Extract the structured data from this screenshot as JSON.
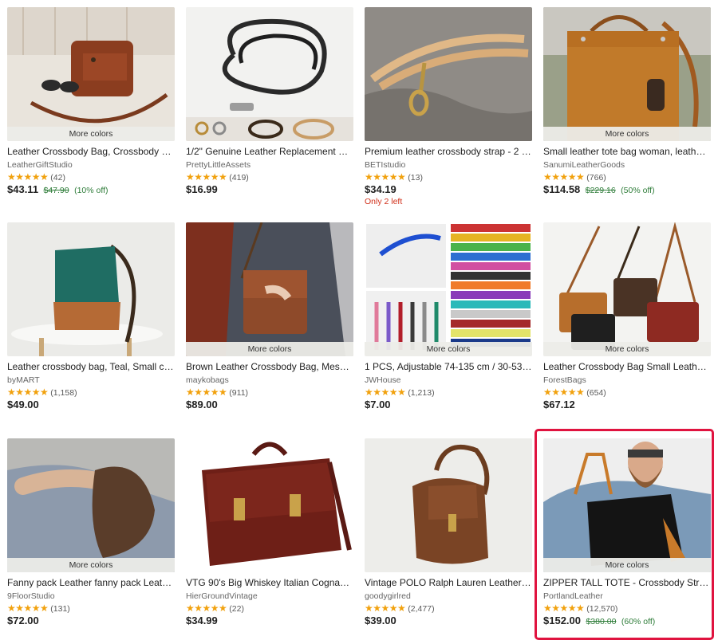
{
  "listings": [
    {
      "more_colors": "More colors",
      "title": "Leather Crossbody Bag, Crossbody Ba...",
      "shop": "LeatherGiftStudio",
      "stars": "★★★★★",
      "reviews": "(42)",
      "price": "$43.11",
      "original_price": "$47.90",
      "discount": "(10% off)"
    },
    {
      "title": "1/2\" Genuine Leather Replacement Str...",
      "shop": "PrettyLittleAssets",
      "stars": "★★★★★",
      "reviews": "(419)",
      "price": "$16.99"
    },
    {
      "title": "Premium leather crossbody strap - 2 si...",
      "shop": "BETIstudio",
      "stars": "★★★★★",
      "reviews": "(13)",
      "price": "$34.19",
      "stock_note": "Only 2 left"
    },
    {
      "more_colors": "More colors",
      "title": "Small leather tote bag woman, leather ...",
      "shop": "SanumiLeatherGoods",
      "stars": "★★★★★",
      "reviews": "(766)",
      "price": "$114.58",
      "original_price": "$229.16",
      "discount": "(50% off)"
    },
    {
      "title": "Leather crossbody bag, Teal, Small cro...",
      "shop": "byMART",
      "stars": "★★★★★",
      "reviews": "(1,158)",
      "price": "$49.00"
    },
    {
      "more_colors": "More colors",
      "title": "Brown Leather Crossbody Bag, Messe...",
      "shop": "maykobags",
      "stars": "★★★★★",
      "reviews": "(911)",
      "price": "$89.00"
    },
    {
      "more_colors": "More colors",
      "title": "1 PCS, Adjustable 74-135 cm / 30-53 in...",
      "shop": "JWHouse",
      "stars": "★★★★★",
      "reviews": "(1,213)",
      "price": "$7.00"
    },
    {
      "more_colors": "More colors",
      "title": "Leather Crossbody Bag Small Leather ...",
      "shop": "ForestBags",
      "stars": "★★★★★",
      "reviews": "(654)",
      "price": "$67.12"
    },
    {
      "more_colors": "More colors",
      "title": "Fanny pack Leather fanny pack Leathe...",
      "shop": "9FloorStudio",
      "stars": "★★★★★",
      "reviews": "(131)",
      "price": "$72.00"
    },
    {
      "title": "VTG 90's Big Whiskey Italian Cognac L...",
      "shop": "HierGroundVintage",
      "stars": "★★★★★",
      "reviews": "(22)",
      "price": "$34.99"
    },
    {
      "title": "Vintage POLO Ralph Lauren Leather Cr...",
      "shop": "goodygirlred",
      "stars": "★★★★★",
      "reviews": "(2,477)",
      "price": "$39.00"
    },
    {
      "more_colors": "More colors",
      "title": "ZIPPER TALL TOTE - Crossbody Strap - ...",
      "shop": "PortlandLeather",
      "stars": "★★★★★",
      "reviews": "(12,570)",
      "price": "$152.00",
      "original_price": "$380.00",
      "discount": "(60% off)"
    }
  ],
  "colors": {
    "star": "#f1a10d",
    "discount_green": "#2f7d3a",
    "stock_red": "#d1301a",
    "highlight_border": "#e0133f"
  }
}
